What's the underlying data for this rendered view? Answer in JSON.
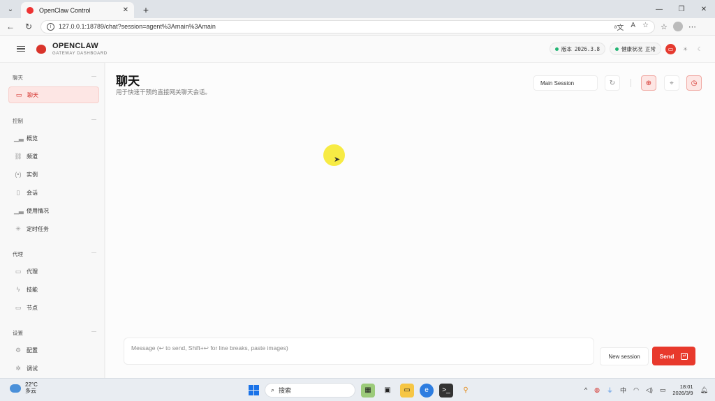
{
  "browser": {
    "tab_title": "OpenClaw Control",
    "url": "127.0.0.1:18789/chat?session=agent%3Amain%3Amain"
  },
  "header": {
    "brand_name": "OPENCLAW",
    "brand_sub": "GATEWAY DASHBOARD",
    "version_label": "版本",
    "version_value": "2026.3.8",
    "health_label": "健康状况",
    "health_value": "正常",
    "colors": {
      "accent": "#e8392c",
      "status_ok": "#22b573"
    }
  },
  "sidebar": {
    "sections": [
      {
        "title": "聊天",
        "items": [
          {
            "label": "聊天",
            "icon": "chat-icon",
            "active": true
          }
        ]
      },
      {
        "title": "控制",
        "items": [
          {
            "label": "概览",
            "icon": "bar-chart-icon"
          },
          {
            "label": "频道",
            "icon": "link-icon"
          },
          {
            "label": "实例",
            "icon": "radio-icon"
          },
          {
            "label": "会话",
            "icon": "document-icon"
          },
          {
            "label": "使用情况",
            "icon": "bar-chart-icon"
          },
          {
            "label": "定时任务",
            "icon": "loader-icon"
          }
        ]
      },
      {
        "title": "代理",
        "items": [
          {
            "label": "代理",
            "icon": "folder-icon"
          },
          {
            "label": "技能",
            "icon": "bolt-icon"
          },
          {
            "label": "节点",
            "icon": "monitor-icon"
          }
        ]
      },
      {
        "title": "设置",
        "items": [
          {
            "label": "配置",
            "icon": "gear-icon"
          },
          {
            "label": "调试",
            "icon": "bug-icon"
          }
        ]
      }
    ]
  },
  "main": {
    "title": "聊天",
    "subtitle": "用于快速干预的直接网关聊天会话。",
    "session_select": "Main Session",
    "composer_placeholder": "Message (↩ to send, Shift+↩ for line breaks, paste images)",
    "new_session_label": "New session",
    "send_label": "Send"
  },
  "taskbar": {
    "temperature": "22°C",
    "weather": "多云",
    "search_label": "搜索",
    "ime": "中",
    "time": "18:01",
    "date": "2026/3/9"
  }
}
